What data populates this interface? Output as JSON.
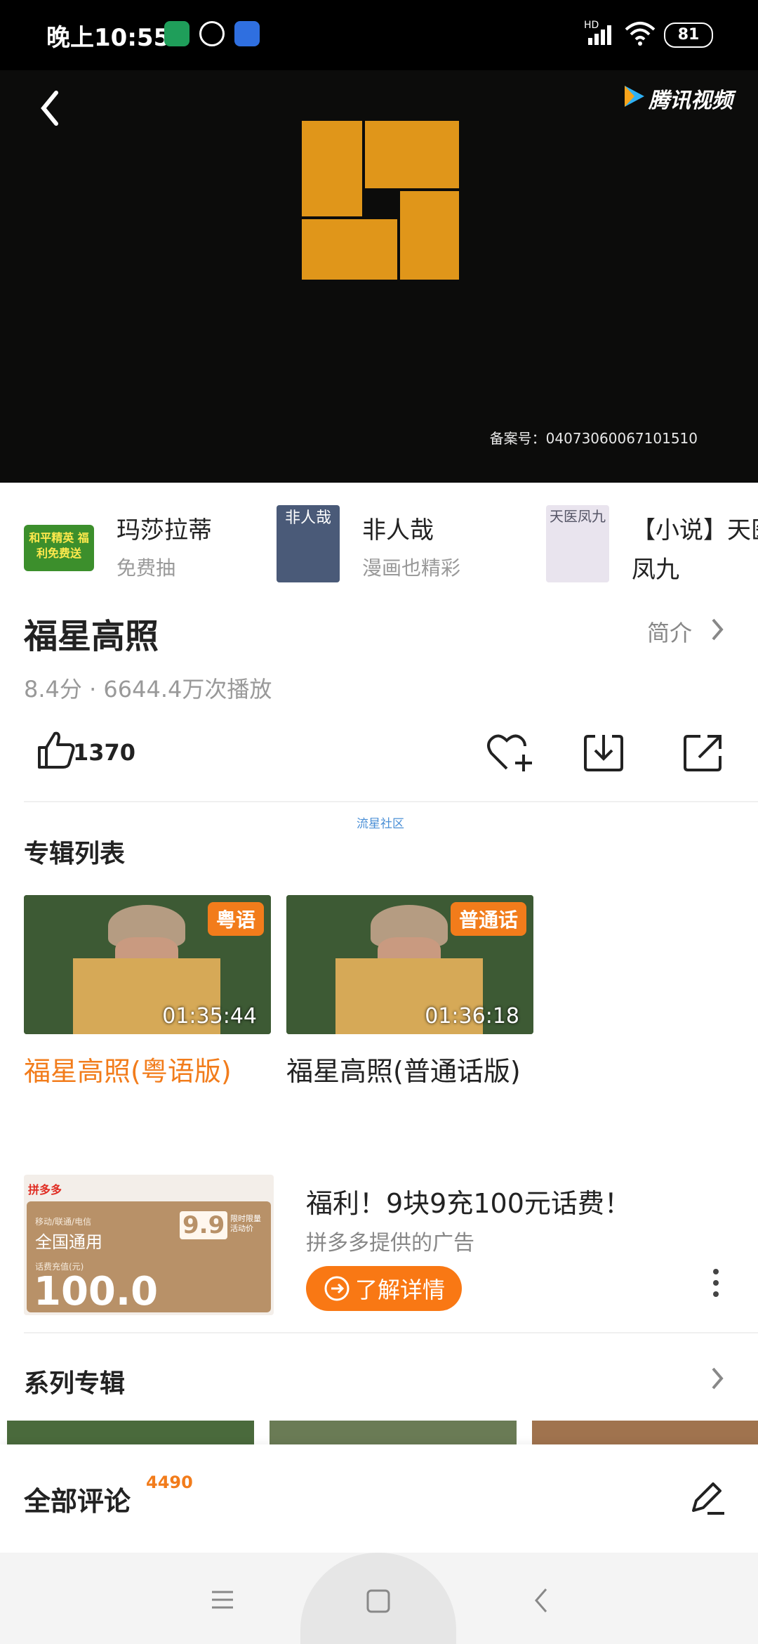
{
  "status_bar": {
    "time": "晚上10:55",
    "battery": "81",
    "network_label": "HD"
  },
  "player": {
    "brand": "腾讯视频",
    "record_number": "备案号：04073060067101510"
  },
  "recommendations": [
    {
      "title": "玛莎拉蒂",
      "subtitle": "免费抽",
      "thumb_text": "和平精英 福利免费送"
    },
    {
      "title": "非人哉",
      "subtitle": "漫画也精彩",
      "thumb_text": "非人哉"
    },
    {
      "title": "【小说】天医",
      "subtitle": "凤九",
      "thumb_text": "天医凤九"
    }
  ],
  "video": {
    "title": "福星高照",
    "intro_label": "简介",
    "meta": "8.4分 · 6644.4万次播放",
    "like_count": "1370"
  },
  "community_link": "流星社区",
  "album_list": {
    "title": "专辑列表",
    "episodes": [
      {
        "tag": "粤语",
        "duration": "01:35:44",
        "title": "福星高照(粤语版)",
        "active": true
      },
      {
        "tag": "普通话",
        "duration": "01:36:18",
        "title": "福星高照(普通话版)",
        "active": false
      }
    ]
  },
  "ad": {
    "brand": "拼多多",
    "card_line1": "移动/联通/电信",
    "card_line2": "全国通用",
    "card_price": "9.9",
    "card_price_tag": "限时限量 活动价",
    "card_value_label": "话费充值(元)",
    "card_value": "100.0",
    "title": "福利！9块9充100元话费！",
    "source": "拼多多提供的广告",
    "cta": "了解详情"
  },
  "series": {
    "title": "系列专辑"
  },
  "comments": {
    "title": "全部评论",
    "count": "4490"
  },
  "colors": {
    "accent": "#f97814",
    "status_bg": "#000000",
    "logo_orange": "#e0961a"
  }
}
